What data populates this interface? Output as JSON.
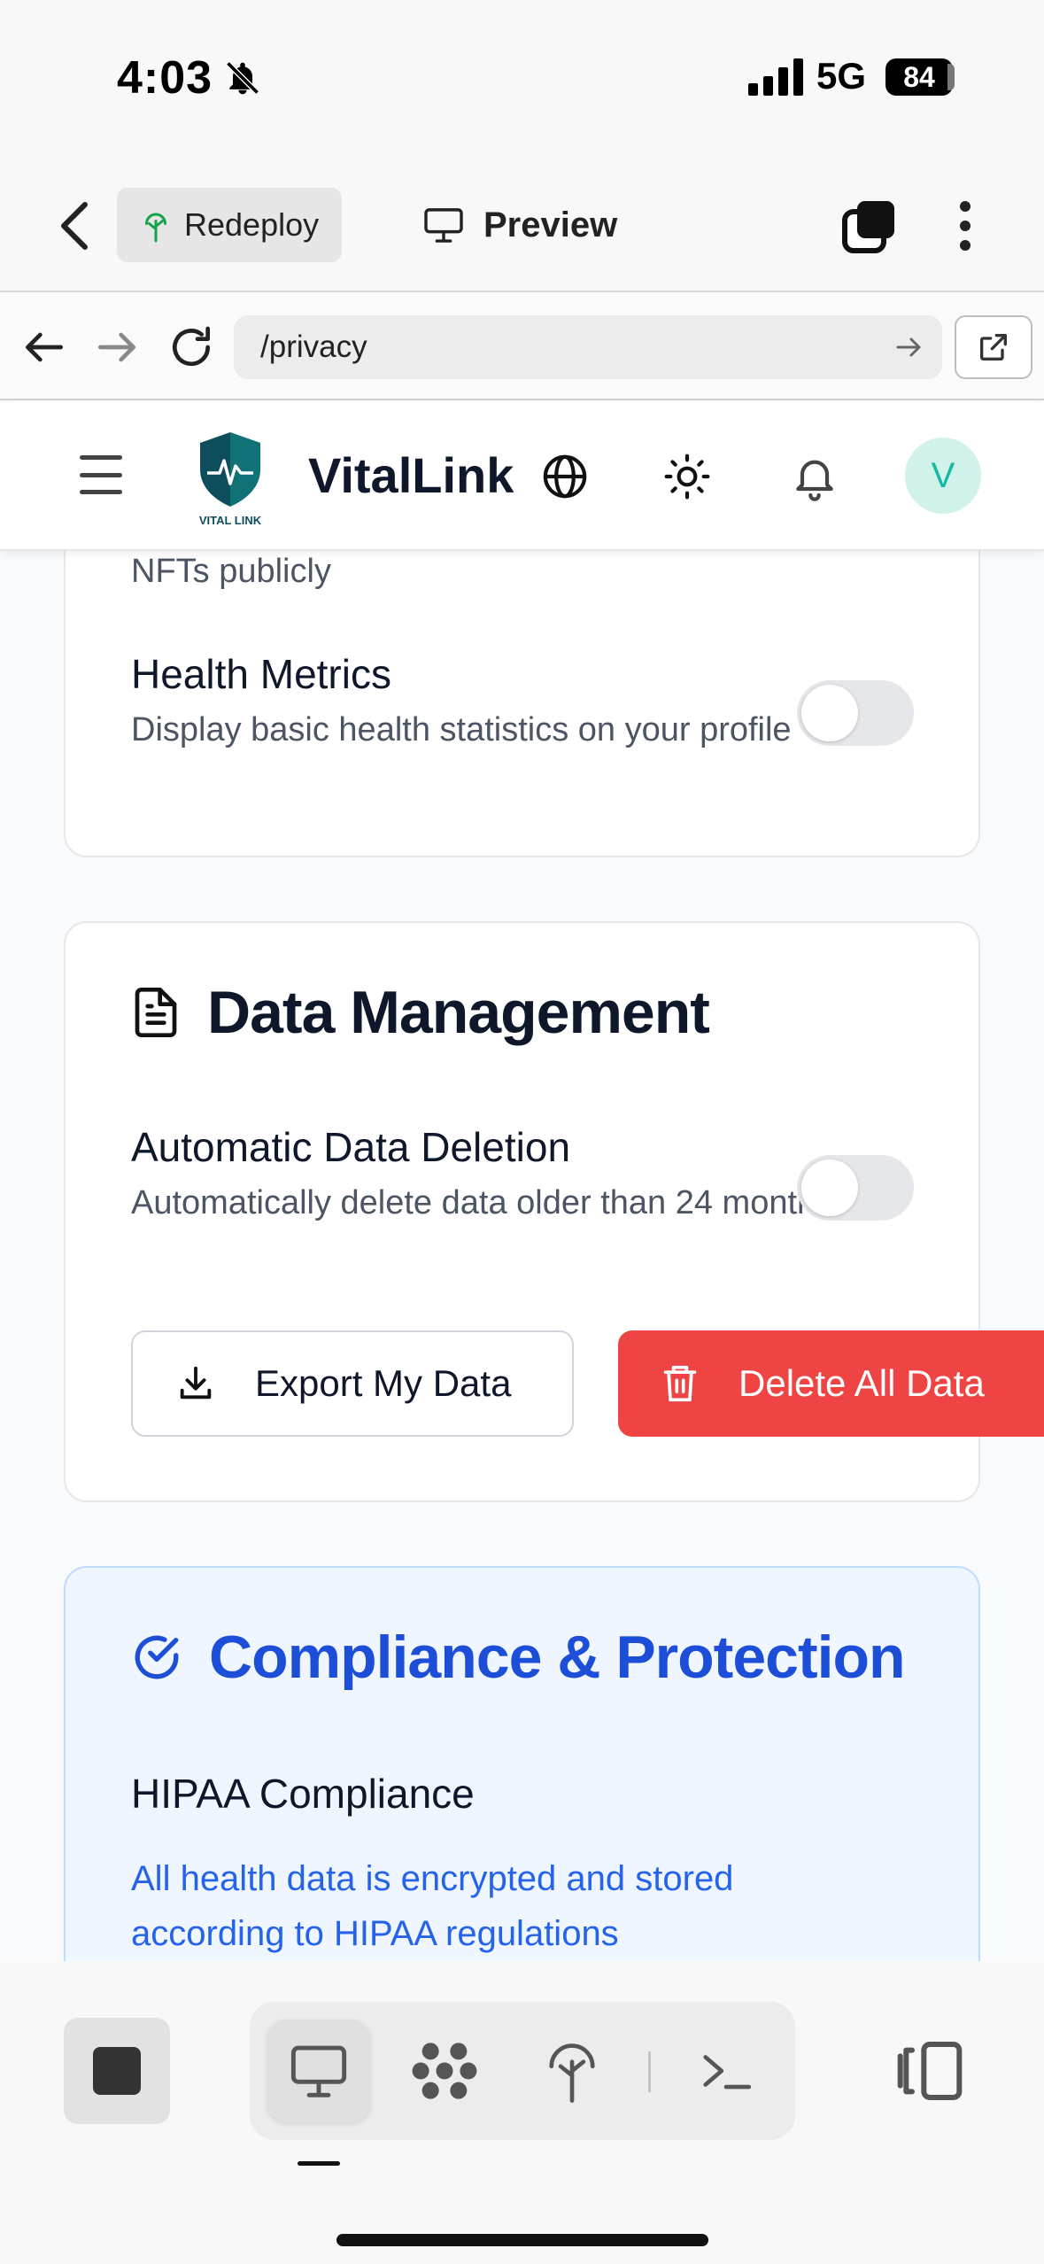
{
  "status_bar": {
    "time": "4:03",
    "network": "5G",
    "battery": "84"
  },
  "app_bar": {
    "redeploy_label": "Redeploy",
    "preview_label": "Preview"
  },
  "browser": {
    "url": "/privacy"
  },
  "site_header": {
    "brand": "VitalLink",
    "logo_text": "VITAL LINK",
    "avatar_letter": "V"
  },
  "profile_card": {
    "clipped_text": "NFTs publicly",
    "health_metrics": {
      "title": "Health Metrics",
      "description": "Display basic health statistics on your profile",
      "enabled": false
    }
  },
  "data_management": {
    "title": "Data Management",
    "auto_deletion": {
      "title": "Automatic Data Deletion",
      "description": "Automatically delete data older than 24 months",
      "enabled": false
    },
    "export_label": "Export My Data",
    "delete_label": "Delete All Data"
  },
  "compliance": {
    "title": "Compliance & Protection",
    "hipaa_title": "HIPAA Compliance",
    "hipaa_description": "All health data is encrypted and stored according to HIPAA regulations"
  },
  "colors": {
    "primary_blue": "#1d4ed8",
    "danger_red": "#ef4444",
    "avatar_bg": "#d1f2ea",
    "avatar_fg": "#14b8a6"
  },
  "icons": {
    "status": [
      "bell-off-icon",
      "signal-icon"
    ],
    "dock": [
      "stop-icon",
      "desktop-icon",
      "apps-icon",
      "deploy-icon",
      "terminal-icon",
      "sidebar-toggle-icon"
    ]
  }
}
